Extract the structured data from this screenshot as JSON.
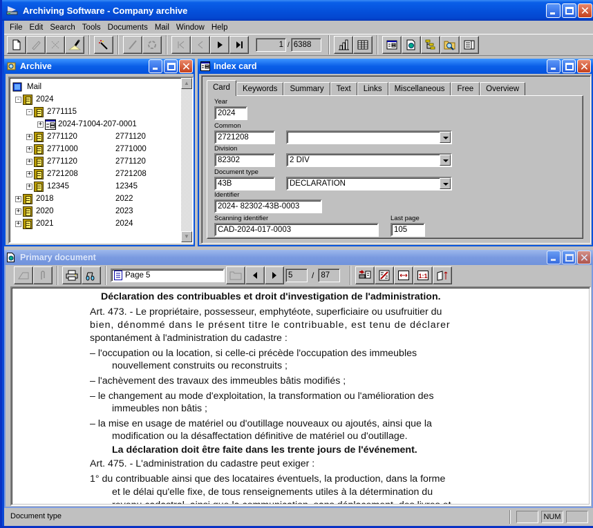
{
  "app": {
    "title": "Archiving Software - Company archive",
    "menu": [
      "File",
      "Edit",
      "Search",
      "Tools",
      "Documents",
      "Mail",
      "Window",
      "Help"
    ],
    "toolbar": {
      "buttons": [
        {
          "name": "new-document",
          "icon": "new-document-icon",
          "enabled": true
        },
        {
          "name": "edit",
          "icon": "pencil-icon",
          "enabled": false
        },
        {
          "name": "cut",
          "icon": "scissors-icon",
          "enabled": false
        },
        {
          "name": "scan",
          "icon": "scanner-icon",
          "enabled": true
        },
        {
          "name": "wizard",
          "icon": "magic-wand-icon",
          "enabled": true
        },
        {
          "name": "annotate",
          "icon": "pen-icon",
          "enabled": false
        },
        {
          "name": "link",
          "icon": "link-icon",
          "enabled": false
        },
        {
          "name": "first-record",
          "icon": "first-icon",
          "enabled": false
        },
        {
          "name": "previous-record",
          "icon": "previous-icon",
          "enabled": false
        },
        {
          "name": "next-record",
          "icon": "next-icon",
          "enabled": true
        },
        {
          "name": "last-record",
          "icon": "last-icon",
          "enabled": true
        }
      ],
      "record_current": "1",
      "record_separator": "/",
      "record_total": "6388",
      "right_buttons": [
        "statistics-icon",
        "table-icon",
        "index-card-icon",
        "primary-document-icon",
        "tree-icon",
        "search-folder-icon",
        "list-view-icon"
      ]
    }
  },
  "archive": {
    "title": "Archive",
    "tree": [
      {
        "label": "Mail",
        "col2": "",
        "level": 0,
        "toggle": "",
        "icon": "mail-icon"
      },
      {
        "label": "2024",
        "col2": "",
        "level": 1,
        "toggle": "-",
        "icon": "binder-icon"
      },
      {
        "label": "2771115",
        "col2": "",
        "level": 2,
        "toggle": "-",
        "icon": "binder-icon"
      },
      {
        "label": "2024-71004-207-0001",
        "col2": "",
        "level": 3,
        "toggle": "+",
        "icon": "index-card-icon"
      },
      {
        "label": "2771120",
        "col2": "2771120",
        "level": 2,
        "toggle": "+",
        "icon": "binder-icon"
      },
      {
        "label": "2771000",
        "col2": "2771000",
        "level": 2,
        "toggle": "+",
        "icon": "binder-icon"
      },
      {
        "label": "2771120",
        "col2": "2771120",
        "level": 2,
        "toggle": "+",
        "icon": "binder-icon"
      },
      {
        "label": "2721208",
        "col2": "2721208",
        "level": 2,
        "toggle": "+",
        "icon": "binder-icon"
      },
      {
        "label": "12345",
        "col2": "12345",
        "level": 2,
        "toggle": "+",
        "icon": "binder-icon"
      },
      {
        "label": "2018",
        "col2": "2022",
        "level": 1,
        "toggle": "+",
        "icon": "binder-icon"
      },
      {
        "label": "2020",
        "col2": "2023",
        "level": 1,
        "toggle": "+",
        "icon": "binder-icon"
      },
      {
        "label": "2021",
        "col2": "2024",
        "level": 1,
        "toggle": "+",
        "icon": "binder-icon"
      }
    ]
  },
  "index_card": {
    "title": "Index card",
    "tabs": [
      "Card",
      "Keywords",
      "Summary",
      "Text",
      "Links",
      "Miscellaneous",
      "Free",
      "Overview"
    ],
    "active_tab": "Card",
    "fields": {
      "year": {
        "label": "Year",
        "value": "2024"
      },
      "common": {
        "label": "Common",
        "value": "2721208",
        "select": ""
      },
      "division": {
        "label": "Division",
        "value": "82302",
        "select": "2 DIV"
      },
      "document_type": {
        "label": "Document type",
        "value": "43B",
        "select": "DECLARATION"
      },
      "identifier": {
        "label": "Identifier",
        "value": "2024- 82302-43B-0003"
      },
      "scanning_identifier": {
        "label": "Scanning identifier",
        "value": "CAD-2024-017-0003"
      },
      "last_page": {
        "label": "Last page",
        "value": "105"
      }
    }
  },
  "primary_document": {
    "title": "Primary document",
    "page_select": "Page 5",
    "page_current": "5",
    "page_separator": "/",
    "page_total": "87",
    "content": [
      {
        "text": "Déclaration des contribuables et droit d'investigation de l'administration.",
        "style": "heading"
      },
      {
        "text": "Art. 473.  -  Le propriétaire, possesseur, emphytéote, superficiaire ou usufruitier du",
        "style": "normal"
      },
      {
        "text": "bien, dénommé dans le présent titre le contribuable, est tenu de déclarer",
        "style": "normal"
      },
      {
        "text": "spontanément à l'administration du cadastre :",
        "style": "normal"
      },
      {
        "text": "–     l'occupation ou la location, si celle-ci précède l'occupation des immeubles",
        "style": "normal"
      },
      {
        "text": "nouvellement construits ou reconstruits ;",
        "style": "indent"
      },
      {
        "text": "–     l'achèvement des travaux des immeubles bâtis modifiés ;",
        "style": "normal"
      },
      {
        "text": "–     le changement au mode d'exploitation, la transformation ou l'amélioration des",
        "style": "normal"
      },
      {
        "text": "immeubles non bâtis ;",
        "style": "indent"
      },
      {
        "text": "–     la mise en usage de matériel ou d'outillage nouveaux ou ajoutés, ainsi que la",
        "style": "normal"
      },
      {
        "text": "modification ou la désaffectation définitive de matériel ou d'outillage.",
        "style": "indent"
      },
      {
        "text": "La déclaration doit être faite dans les trente jours de l'événement.",
        "style": "bold-indent"
      },
      {
        "text": "Art. 475.  -  L'administration du cadastre peut exiger :",
        "style": "normal"
      },
      {
        "text": "1°    du contribuable ainsi que des locataires éventuels, la production, dans la forme",
        "style": "normal"
      },
      {
        "text": "et le délai qu'elle fixe, de tous renseignements utiles à la détermination du",
        "style": "indent"
      },
      {
        "text": "revenu cadastral, ainsi que la communication, sans déplacement, des livres et",
        "style": "indent"
      }
    ]
  },
  "statusbar": {
    "message": "Document type",
    "indicators": [
      "",
      "NUM",
      ""
    ]
  },
  "colors": {
    "title_active": "#0552dc",
    "title_inactive": "#7a9ae0",
    "face": "#c0c0c0",
    "close_button": "#c4401d"
  }
}
